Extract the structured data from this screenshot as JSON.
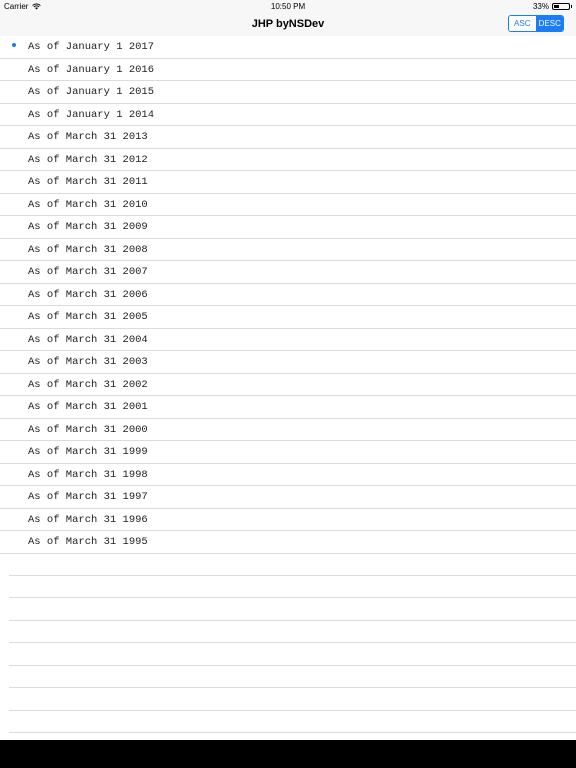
{
  "status_bar": {
    "carrier": "Carrier",
    "time": "10:50 PM",
    "battery_percent_text": "33%",
    "battery_level": 0.33
  },
  "nav": {
    "title": "JHP byNSDev",
    "sort_options": [
      "ASC",
      "DESC"
    ],
    "selected_sort": "DESC"
  },
  "list": {
    "selected_index": 0,
    "items": [
      "As of January 1 2017",
      "As of January 1 2016",
      "As of January 1 2015",
      "As of January 1 2014",
      "As of March 31 2013",
      "As of March 31 2012",
      "As of March 31 2011",
      "As of March 31 2010",
      "As of March 31 2009",
      "As of March 31 2008",
      "As of March 31 2007",
      "As of March 31 2006",
      "As of March 31 2005",
      "As of March 31 2004",
      "As of March 31 2003",
      "As of March 31 2002",
      "As of March 31 2001",
      "As of March 31 2000",
      "As of March 31 1999",
      "As of March 31 1998",
      "As of March 31 1997",
      "As of March 31 1996",
      "As of March 31 1995"
    ]
  },
  "colors": {
    "accent": "#1a7cf7",
    "separator": "#dcdcdc"
  },
  "icons": {
    "wifi": "wifi-icon",
    "battery": "battery-icon",
    "selection": "selection-dot-icon"
  }
}
